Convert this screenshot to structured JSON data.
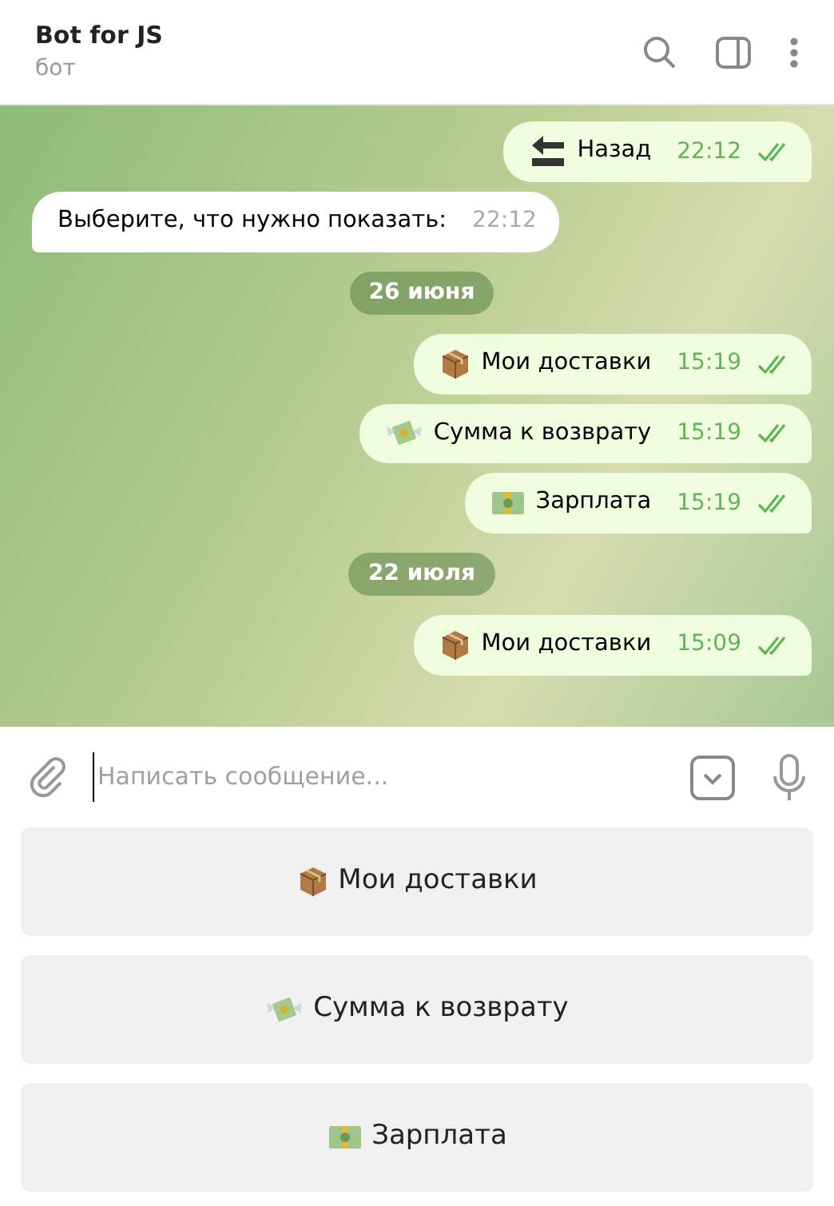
{
  "header": {
    "title": "Bot for JS",
    "subtitle": "бот"
  },
  "messages": [
    {
      "kind": "back",
      "text": "Назад",
      "time": "22:12",
      "read": true
    },
    {
      "kind": "incoming",
      "text": "Выберите, что нужно показать:",
      "time": "22:12"
    },
    {
      "kind": "date",
      "text": "26 июня"
    },
    {
      "kind": "box",
      "text": "Мои доставки",
      "time": "15:19",
      "read": true
    },
    {
      "kind": "money",
      "text": "Сумма к возврату",
      "time": "15:19",
      "read": true
    },
    {
      "kind": "banknote",
      "text": "Зарплата",
      "time": "15:19",
      "read": true
    },
    {
      "kind": "date",
      "text": "22 июля"
    },
    {
      "kind": "box",
      "text": "Мои доставки",
      "time": "15:09",
      "read": true
    }
  ],
  "composer": {
    "placeholder": "Написать сообщение..."
  },
  "keyboard": [
    {
      "kind": "box",
      "label": "Мои доставки"
    },
    {
      "kind": "money",
      "label": "Сумма к возврату"
    },
    {
      "kind": "banknote",
      "label": "Зарплата"
    }
  ]
}
